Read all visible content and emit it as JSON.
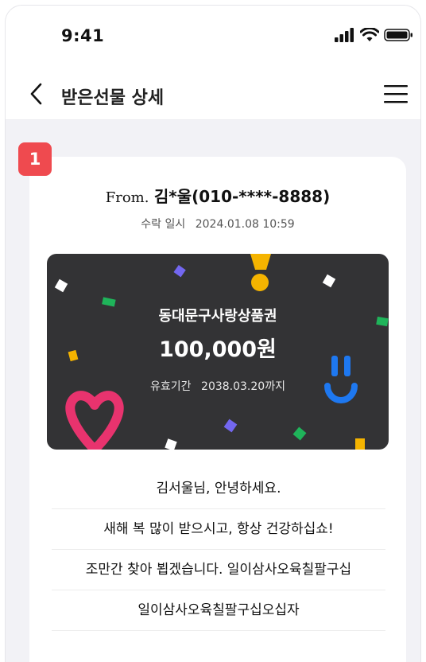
{
  "status_bar": {
    "time": "9:41",
    "icons": [
      "signal-icon",
      "wifi-icon",
      "battery-icon"
    ]
  },
  "navbar": {
    "back_icon": "chevron-left-icon",
    "title": "받은선물 상세",
    "menu_icon": "hamburger-menu-icon"
  },
  "badge": {
    "number": "1",
    "color": "#ef4a4f"
  },
  "gift_detail": {
    "from_label": "From.",
    "from_name": "김*울(010-****-8888)",
    "received_label": "수락 일시",
    "received_at": "2024.01.08 10:59"
  },
  "gift_card": {
    "name": "동대문구사랑상품권",
    "amount": "100,000원",
    "validity_label": "유효기간",
    "validity_value": "2038.03.20까지",
    "background": "#333335",
    "decorations": [
      "heart-icon",
      "smile-icon",
      "exclamation-icon"
    ]
  },
  "messages": [
    "김서울님, 안녕하세요.",
    "새해 복 많이 받으시고, 항상 건강하십쇼!",
    "조만간 찾아 뵙겠습니다. 일이삼사오육칠팔구십",
    "일이삼사오육칠팔구십오십자"
  ]
}
